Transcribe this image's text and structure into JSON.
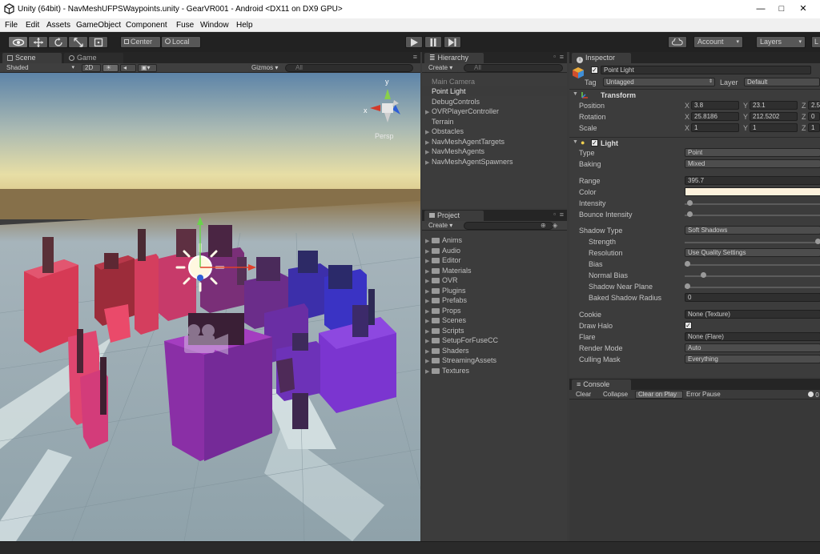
{
  "window": {
    "title": "Unity (64bit) - NavMeshUFPSWaypoints.unity - GearVR001 - Android <DX11 on DX9 GPU>",
    "controls": {
      "minimize": "—",
      "maximize": "□",
      "close": "✕"
    }
  },
  "menu": [
    "File",
    "Edit",
    "Assets",
    "GameObject",
    "Component",
    "Fuse",
    "Window",
    "Help"
  ],
  "toolbar": {
    "pivot": "Center",
    "space": "Local",
    "account": "Account",
    "layers": "Layers",
    "layout": "L"
  },
  "scene": {
    "tabs": [
      "Scene",
      "Game"
    ],
    "shading": "Shaded",
    "mode2d": "2D",
    "gizmos": "Gizmos",
    "search_placeholder": "All",
    "persp": "Persp",
    "gizmo_axes": {
      "x": "x",
      "y": "y"
    }
  },
  "hierarchy": {
    "tab": "Hierarchy",
    "create": "Create",
    "search_placeholder": "All",
    "items": [
      {
        "label": "Main Camera",
        "expandable": false,
        "dim": true
      },
      {
        "label": "Point Light",
        "expandable": false,
        "selected": true
      },
      {
        "label": "DebugControls",
        "expandable": false
      },
      {
        "label": "OVRPlayerController",
        "expandable": true
      },
      {
        "label": "Terrain",
        "expandable": false
      },
      {
        "label": "Obstacles",
        "expandable": true
      },
      {
        "label": "NavMeshAgentTargets",
        "expandable": true
      },
      {
        "label": "NavMeshAgents",
        "expandable": true
      },
      {
        "label": "NavMeshAgentSpawners",
        "expandable": true
      }
    ]
  },
  "project": {
    "tab": "Project",
    "create": "Create",
    "folders": [
      "Anims",
      "Audio",
      "Editor",
      "Materials",
      "OVR",
      "Plugins",
      "Prefabs",
      "Props",
      "Scenes",
      "Scripts",
      "SetupForFuseCC",
      "Shaders",
      "StreamingAssets",
      "Textures"
    ]
  },
  "inspector": {
    "tab": "Inspector",
    "object_name": "Point Light",
    "tag_label": "Tag",
    "tag_value": "Untagged",
    "layer_label": "Layer",
    "layer_value": "Default",
    "transform": {
      "header": "Transform",
      "rows": [
        {
          "label": "Position",
          "x": "3.8",
          "y": "23.1",
          "z": "2.5"
        },
        {
          "label": "Rotation",
          "x": "25.8186",
          "y": "212.5202",
          "z": "0"
        },
        {
          "label": "Scale",
          "x": "1",
          "y": "1",
          "z": "1"
        }
      ],
      "axis_x": "X",
      "axis_y": "Y",
      "axis_z": "Z"
    },
    "light": {
      "header": "Light",
      "type_label": "Type",
      "type_value": "Point",
      "baking_label": "Baking",
      "baking_value": "Mixed",
      "range_label": "Range",
      "range_value": "395.7",
      "color_label": "Color",
      "color_value": "#fdf1dc",
      "intensity_label": "Intensity",
      "intensity_value": 0.02,
      "bounce_label": "Bounce Intensity",
      "bounce_value": 0.02,
      "shadow_type_label": "Shadow Type",
      "shadow_type_value": "Soft Shadows",
      "strength_label": "Strength",
      "strength_value": 1.0,
      "resolution_label": "Resolution",
      "resolution_value": "Use Quality Settings",
      "bias_label": "Bias",
      "bias_value": 0.0,
      "normal_bias_label": "Normal Bias",
      "normal_bias_value": 0.12,
      "near_plane_label": "Shadow Near Plane",
      "near_plane_value": 0.0,
      "baked_radius_label": "Baked Shadow Radius",
      "baked_radius_value": "0",
      "cookie_label": "Cookie",
      "cookie_value": "None (Texture)",
      "draw_halo_label": "Draw Halo",
      "flare_label": "Flare",
      "flare_value": "None (Flare)",
      "render_mode_label": "Render Mode",
      "render_mode_value": "Auto",
      "culling_label": "Culling Mask",
      "culling_value": "Everything"
    }
  },
  "console": {
    "tab": "Console",
    "buttons": [
      "Clear",
      "Collapse",
      "Clear on Play",
      "Error Pause"
    ],
    "active_button": "Clear on Play",
    "counter": "0"
  },
  "colors": {
    "accent_selection": "#3d5a80",
    "panel_bg": "#3c3c3c",
    "light_color": "#fdf1dc"
  }
}
